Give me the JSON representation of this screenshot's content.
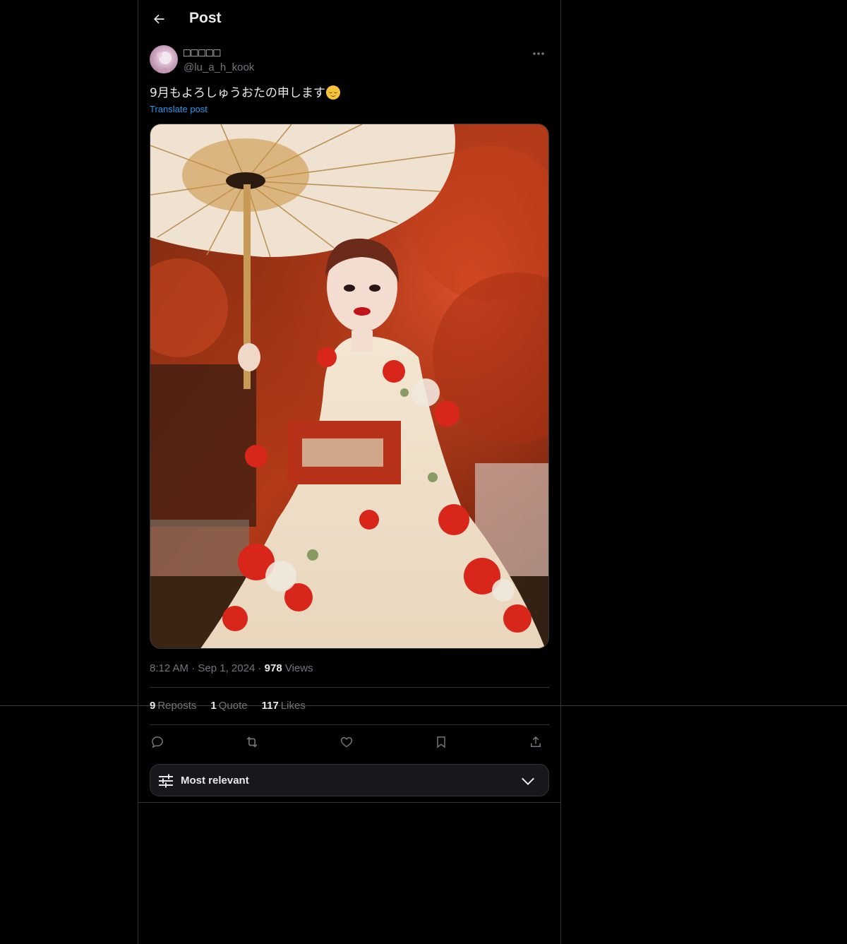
{
  "header": {
    "title": "Post",
    "back_icon": "arrow-left-icon"
  },
  "post": {
    "author": {
      "display_name": "□□□□□",
      "handle": "@lu_a_h_kook"
    },
    "text": "9月もよろしゅうおたの申します",
    "emoji": "relieved-face",
    "translate_label": "Translate post",
    "media_alt": "",
    "time": "8:12 AM",
    "date": "Sep 1, 2024",
    "views_count": "978",
    "views_label": "Views",
    "separator": "·"
  },
  "stats": {
    "reposts_count": "9",
    "reposts_label": "Reposts",
    "quotes_count": "1",
    "quotes_label": "Quote",
    "likes_count": "117",
    "likes_label": "Likes"
  },
  "actions": [
    "reply-icon",
    "repost-icon",
    "like-icon",
    "bookmark-icon",
    "share-icon"
  ],
  "sort": {
    "label": "Most relevant"
  },
  "colors": {
    "background": "#000000",
    "text": "#e7e9ea",
    "muted": "#71767b",
    "accent": "#1d9bf0",
    "border": "#2f3336"
  }
}
